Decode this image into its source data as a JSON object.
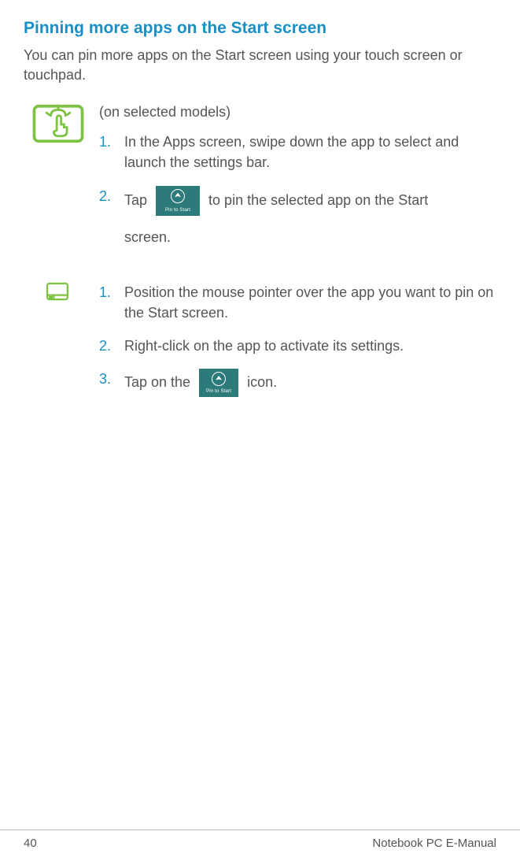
{
  "heading": "Pinning more apps on the Start screen",
  "intro": "You can pin more apps on the Start screen using your touch screen or touchpad.",
  "touch": {
    "note": "(on selected models)",
    "steps": [
      {
        "num": "1.",
        "text": "In the Apps screen, swipe down the app to select and launch the settings bar."
      },
      {
        "num": "2.",
        "pre": "Tap ",
        "post": " to pin the selected app on the Start",
        "line2": "screen."
      }
    ]
  },
  "touchpad": {
    "steps": [
      {
        "num": "1.",
        "text": "Position the mouse pointer over the app you want to pin on the Start screen."
      },
      {
        "num": "2.",
        "text": "Right-click on the app to activate its settings."
      },
      {
        "num": "3.",
        "pre": "Tap on the ",
        "post": " icon."
      }
    ]
  },
  "pin_tile_label": "Pin to Start",
  "footer": {
    "page": "40",
    "title": "Notebook PC E-Manual"
  }
}
